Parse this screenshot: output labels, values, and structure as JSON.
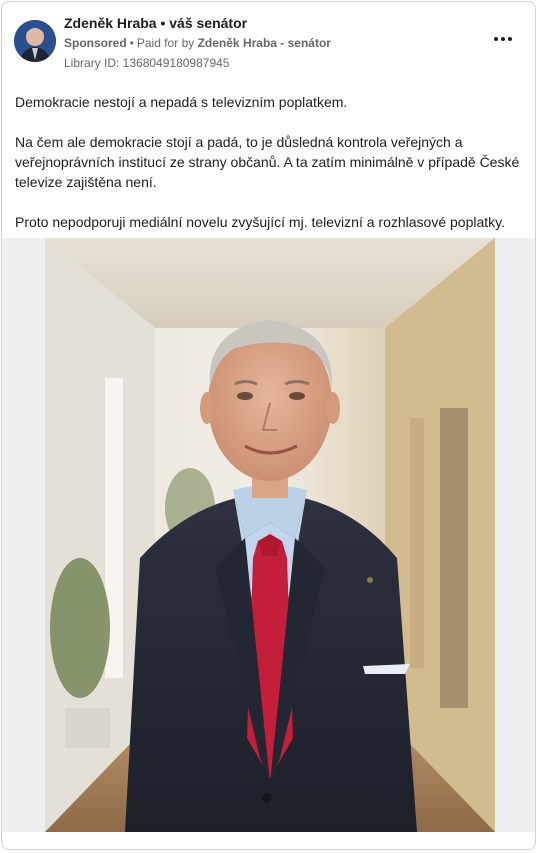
{
  "post": {
    "author": "Zdeněk Hraba • váš senátor",
    "sponsored_label": "Sponsored",
    "paid_for_prefix": "Paid for by",
    "paid_for_by": "Zdeněk Hraba - senátor",
    "library_id": "Library ID: 1368049180987945",
    "paragraphs": [
      "Demokracie nestojí a nepadá s televizním poplatkem.",
      "Na čem ale demokracie stojí a padá, to je důsledná kontrola veřejných a veřejnoprávních institucí ze strany občanů. A ta zatím minimálně v případě České televize zajištěna není.",
      "Proto nepodporuji mediální novelu zvyšující mj. televizní a rozhlasové poplatky."
    ]
  },
  "icons": {
    "more": "more-options-icon"
  }
}
